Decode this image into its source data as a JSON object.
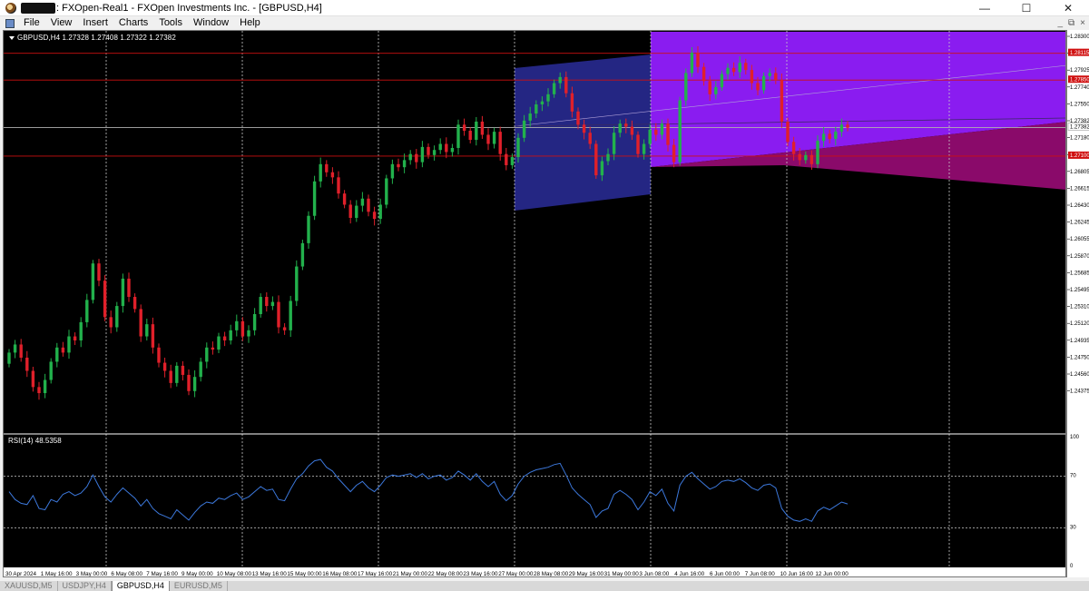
{
  "window": {
    "title": ": FXOpen-Real1 - FXOpen Investments Inc. - [GBPUSD,H4]",
    "minimize": "—",
    "maximize": "☐",
    "close": "✕"
  },
  "menu": {
    "items": [
      "File",
      "View",
      "Insert",
      "Charts",
      "Tools",
      "Window",
      "Help"
    ],
    "right_controls": [
      "_",
      "⧉",
      "×"
    ]
  },
  "chart": {
    "symbol_line": "GBPUSD,H4  1.27328 1.27408 1.27322 1.27382",
    "rsi_label": "RSI(14) 48.5358",
    "colors": {
      "background": "#000000",
      "bull": "#22b14c",
      "bear": "#e0202a",
      "grid": "#c8c8c8",
      "channel_blue": "#26288a",
      "channel_purple": "#8a1cf0",
      "channel_magenta": "#8a0a6a",
      "rsi_line": "#3c78dc",
      "level_line": "#cc1010"
    }
  },
  "price_axis": {
    "labels": [
      "1.28300",
      "1.28115",
      "1.27925",
      "1.27740",
      "1.27550",
      "1.27382",
      "1.27180",
      "1.26990",
      "1.26805",
      "1.26615",
      "1.26430",
      "1.26245",
      "1.26055",
      "1.25870",
      "1.25685",
      "1.25495",
      "1.25310",
      "1.25120",
      "1.24935",
      "1.24750",
      "1.24560",
      "1.24375"
    ],
    "marked": [
      "1.28115",
      "1.27850",
      "1.27382",
      "1.27100"
    ],
    "rsi_labels": [
      "100",
      "70",
      "30",
      "0"
    ]
  },
  "time_axis": {
    "labels": [
      "30 Apr 2024",
      "1 May 16:00",
      "3 May 00:00",
      "6 May 08:00",
      "7 May 16:00",
      "9 May 00:00",
      "10 May 08:00",
      "13 May 16:00",
      "15 May 00:00",
      "16 May 08:00",
      "17 May 16:00",
      "21 May 00:00",
      "22 May 08:00",
      "23 May 16:00",
      "27 May 00:00",
      "28 May 08:00",
      "29 May 16:00",
      "31 May 00:00",
      "3 Jun 08:00",
      "4 Jun 16:00",
      "6 Jun 00:00",
      "7 Jun 08:00",
      "10 Jun 16:00",
      "12 Jun 00:00"
    ]
  },
  "chart_data": {
    "type": "candlestick",
    "symbol": "GBPUSD",
    "timeframe": "H4",
    "ylim": [
      1.24375,
      1.283
    ],
    "horizontal_levels": [
      1.28115,
      1.2785,
      1.27382,
      1.271
    ],
    "candle_closes": [
      1.2516,
      1.2524,
      1.2511,
      1.2498,
      1.2482,
      1.2476,
      1.2489,
      1.2507,
      1.2521,
      1.2516,
      1.2532,
      1.2528,
      1.2546,
      1.2568,
      1.2604,
      1.2587,
      1.2551,
      1.2541,
      1.2562,
      1.2589,
      1.2571,
      1.2559,
      1.2532,
      1.2544,
      1.2521,
      1.2506,
      1.2498,
      1.2486,
      1.2503,
      1.2494,
      1.2478,
      1.2492,
      1.2507,
      1.2521,
      1.2519,
      1.2532,
      1.2528,
      1.2538,
      1.2547,
      1.2532,
      1.2538,
      1.2554,
      1.2571,
      1.2562,
      1.2566,
      1.2541,
      1.2538,
      1.2567,
      1.2601,
      1.2624,
      1.2651,
      1.2685,
      1.2702,
      1.2694,
      1.2689,
      1.2673,
      1.2662,
      1.2649,
      1.2661,
      1.2668,
      1.2655,
      1.2648,
      1.2662,
      1.2688,
      1.2702,
      1.2699,
      1.2706,
      1.2712,
      1.2704,
      1.2719,
      1.2711,
      1.2716,
      1.2722,
      1.2714,
      1.2718,
      1.2741,
      1.2735,
      1.2726,
      1.2744,
      1.2731,
      1.2722,
      1.2734,
      1.2712,
      1.2701,
      1.2709,
      1.2728,
      1.2745,
      1.2752,
      1.2761,
      1.2764,
      1.2771,
      1.2782,
      1.2788,
      1.2772,
      1.2754,
      1.2741,
      1.2733,
      1.2722,
      1.2691,
      1.2705,
      1.2712,
      1.2733,
      1.2742,
      1.2739,
      1.2731,
      1.2712,
      1.2722,
      1.2736,
      1.2731,
      1.2742,
      1.2721,
      1.2704,
      1.2765,
      1.2792,
      1.2812,
      1.2798,
      1.2784,
      1.2771,
      1.2778,
      1.2791,
      1.2797,
      1.2793,
      1.2802,
      1.2795,
      1.2782,
      1.2775,
      1.2789,
      1.2792,
      1.2785,
      1.2744,
      1.2724,
      1.2712,
      1.2706,
      1.2711,
      1.2702,
      1.2725,
      1.2732,
      1.2727,
      1.2734,
      1.2741,
      1.2738
    ]
  },
  "rsi_data": {
    "period": 14,
    "last_value": 48.5358,
    "levels": [
      70,
      30
    ],
    "values": [
      58,
      52,
      49,
      48,
      55,
      45,
      44,
      52,
      50,
      56,
      58,
      55,
      57,
      62,
      71,
      62,
      54,
      50,
      56,
      61,
      57,
      53,
      47,
      52,
      45,
      41,
      39,
      37,
      44,
      40,
      36,
      42,
      47,
      50,
      49,
      53,
      52,
      55,
      57,
      52,
      54,
      58,
      62,
      59,
      60,
      52,
      51,
      60,
      68,
      72,
      78,
      82,
      83,
      77,
      74,
      68,
      63,
      58,
      63,
      66,
      61,
      58,
      63,
      69,
      71,
      70,
      71,
      72,
      69,
      72,
      68,
      70,
      71,
      67,
      69,
      74,
      71,
      67,
      72,
      66,
      62,
      66,
      56,
      51,
      55,
      64,
      70,
      73,
      75,
      76,
      77,
      79,
      80,
      71,
      61,
      56,
      52,
      48,
      38,
      43,
      45,
      56,
      59,
      56,
      52,
      44,
      50,
      58,
      55,
      60,
      49,
      43,
      63,
      70,
      73,
      68,
      64,
      60,
      62,
      66,
      67,
      66,
      68,
      65,
      61,
      59,
      63,
      64,
      61,
      45,
      39,
      36,
      35,
      37,
      35,
      43,
      46,
      44,
      47,
      50,
      48.5
    ]
  },
  "tabs": {
    "items": [
      "XAUUSD,M5",
      "USDJPY,H4",
      "GBPUSD,H4",
      "EURUSD,M5"
    ],
    "active": "GBPUSD,H4"
  }
}
